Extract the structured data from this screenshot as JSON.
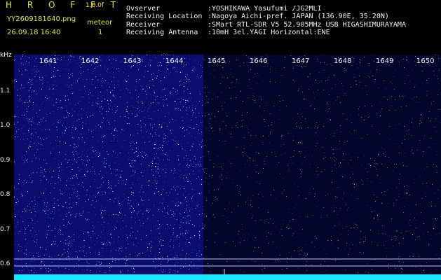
{
  "brand": "H R O F F T",
  "version": "1.0.0f",
  "filename": "YY2609181640.png",
  "datetime": "26.09.18 16:40",
  "meteor_label": "meteor",
  "meteor_count": "1",
  "info": {
    "observer_label": "Ovserver",
    "observer_value": ":YOSHIKAWA Yasufumi /JG2MLI",
    "location_label": "Receiving Location",
    "location_value": ":Nagoya Aichi-pref. JAPAN (136.90E, 35.20N)",
    "receiver_label": "Receiver",
    "receiver_value": ":SMart RTL-SDR V5 52.905MHz USB HIGASHIMURAYAMA",
    "antenna_label": "Receiving Antenna",
    "antenna_value": ":10mH 3el.YAGI Horizontal:ENE"
  },
  "y_axis": {
    "unit": "kHz",
    "ticks": [
      "1.1",
      "1.0",
      "0.9",
      "0.8",
      "0.7",
      "0.6"
    ]
  },
  "x_ticks": [
    "1641",
    "1642",
    "1643",
    "1644",
    "1645",
    "1646",
    "1647",
    "1648",
    "1649",
    "1650"
  ],
  "colors": {
    "background_dense": "#0a0c6e",
    "background_sparse": "#04052a",
    "noise": "#8fa8ff",
    "baseline": "#19e6ff",
    "header_text": "#e6e61a"
  }
}
